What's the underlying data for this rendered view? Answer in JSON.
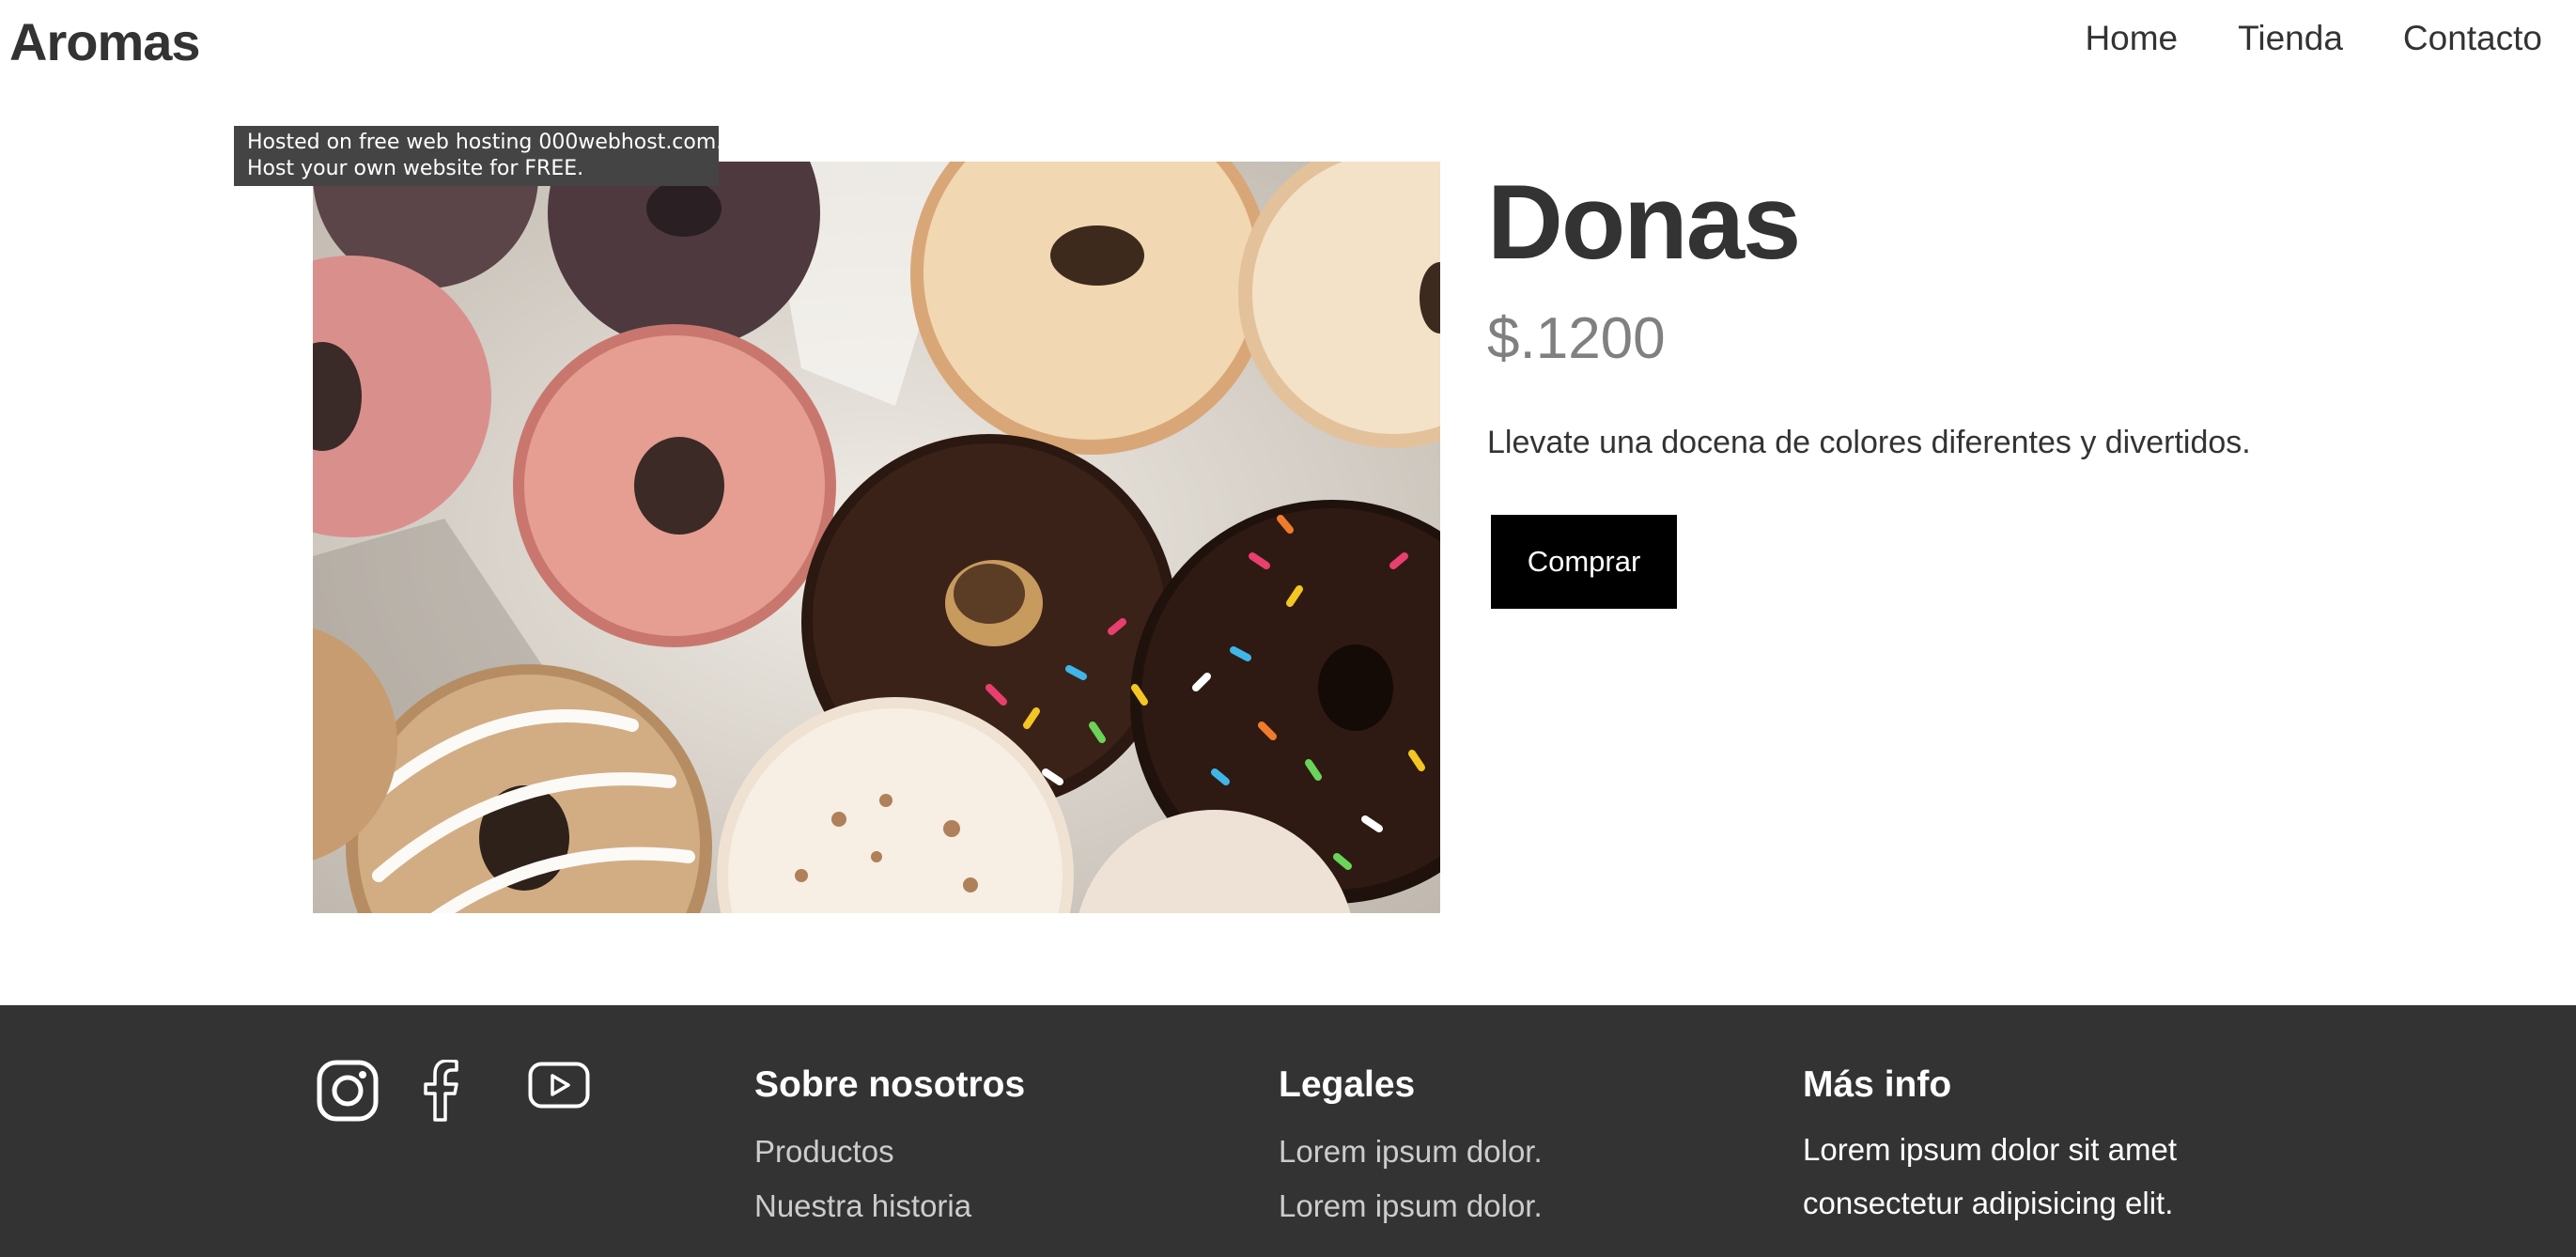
{
  "header": {
    "logo": "Aromas",
    "nav": [
      {
        "label": "Home"
      },
      {
        "label": "Tienda"
      },
      {
        "label": "Contacto"
      }
    ]
  },
  "hosting_banner": {
    "line1": "Hosted on free web hosting 000webhost.com.",
    "line2": "Host your own website for FREE."
  },
  "product": {
    "image_icon": "donuts-photo",
    "title": "Donas",
    "price": "$.1200",
    "description": "Llevate una docena de colores diferentes y divertidos.",
    "buy_label": "Comprar"
  },
  "footer": {
    "background": "#333333",
    "social_icons": [
      "instagram-icon",
      "facebook-icon",
      "youtube-icon"
    ],
    "about": {
      "title": "Sobre nosotros",
      "links": [
        "Productos",
        "Nuestra historia"
      ]
    },
    "legal": {
      "title": "Legales",
      "links": [
        "Lorem ipsum dolor.",
        "Lorem ipsum dolor."
      ]
    },
    "more": {
      "title": "Más info",
      "text": "Lorem ipsum dolor sit amet consectetur adipisicing elit."
    }
  }
}
